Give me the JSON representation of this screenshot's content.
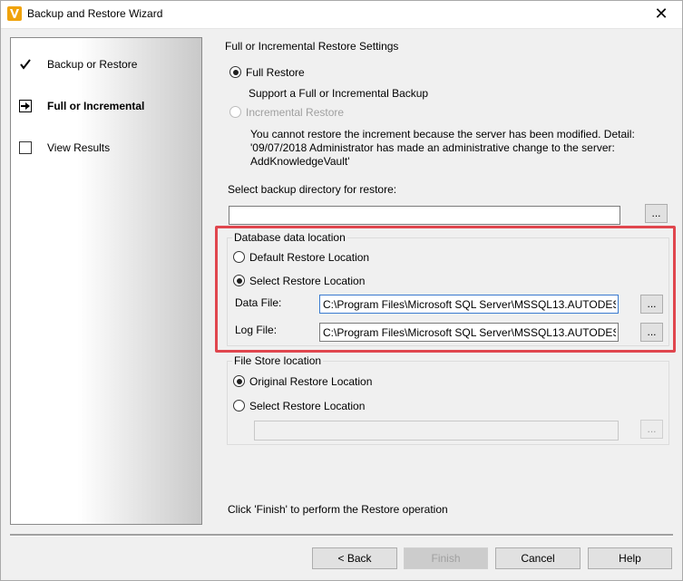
{
  "window": {
    "title": "Backup and Restore Wizard",
    "close_glyph": "✕"
  },
  "sidebar": {
    "steps": [
      {
        "label": "Backup or Restore",
        "icon": "checkmark-icon",
        "state": "done"
      },
      {
        "label": "Full or Incremental",
        "icon": "arrow-right-icon",
        "state": "current"
      },
      {
        "label": "View Results",
        "icon": "empty-checkbox-icon",
        "state": "pending"
      }
    ]
  },
  "main": {
    "section_title": "Full or Incremental Restore Settings",
    "full_restore_label": "Full Restore",
    "full_restore_desc": "Support a Full or Incremental Backup",
    "incremental_label": "Incremental Restore",
    "incremental_desc": "You cannot restore the increment because the server has been modified. Detail: '09/07/2018 Administrator has made an administrative change to the server: AddKnowledgeVault'",
    "backup_dir_label": "Select backup directory for restore:",
    "backup_dir_value": "",
    "browse_label": "..."
  },
  "database_group": {
    "title": "Database data location",
    "default_label": "Default Restore Location",
    "select_label": "Select Restore Location",
    "selected": "select",
    "data_file_label": "Data File:",
    "data_file_value": "C:\\Program Files\\Microsoft SQL Server\\MSSQL13.AUTODESK\\",
    "log_file_label": "Log File:",
    "log_file_value": "C:\\Program Files\\Microsoft SQL Server\\MSSQL13.AUTODESK\\",
    "browse_label": "..."
  },
  "filestore_group": {
    "title": "File Store location",
    "original_label": "Original Restore Location",
    "select_label": "Select Restore Location",
    "selected": "original",
    "path_value": "",
    "browse_label": "..."
  },
  "footer": {
    "hint": "Click 'Finish' to perform the Restore operation",
    "back_label": "< Back",
    "finish_label": "Finish",
    "cancel_label": "Cancel",
    "help_label": "Help"
  },
  "colors": {
    "highlight": "#e0464e",
    "app_icon": "#f0a30a"
  }
}
